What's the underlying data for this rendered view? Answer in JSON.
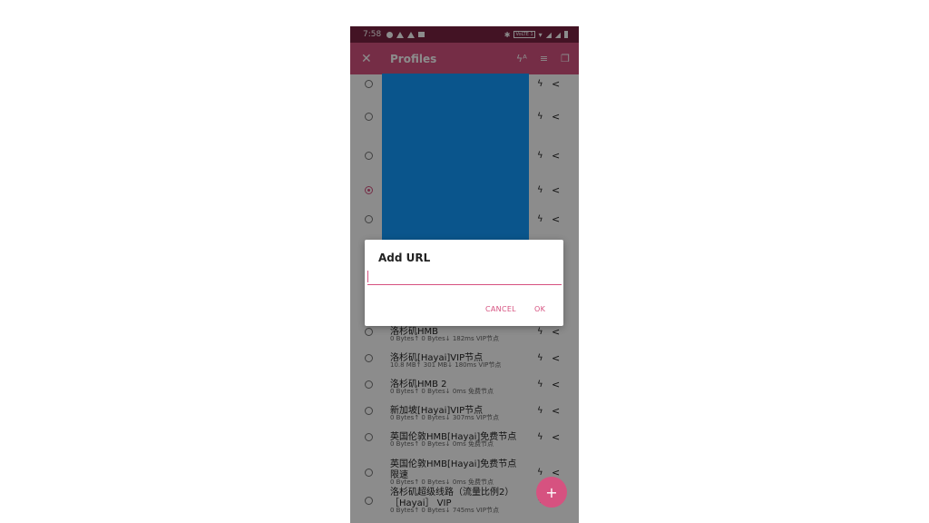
{
  "status_bar": {
    "time": "7:58",
    "network_label": "VoLTE 1"
  },
  "app_bar": {
    "close_icon": "close-icon",
    "title": "Profiles",
    "actions": [
      "speed-test-icon",
      "sort-icon",
      "copy-icon"
    ]
  },
  "profiles": [
    {
      "name": "",
      "info": "",
      "selected": false
    },
    {
      "name": "",
      "info": "",
      "selected": false
    },
    {
      "name": "",
      "info": "",
      "selected": false
    },
    {
      "name": "",
      "info": "",
      "selected": true
    },
    {
      "name": "",
      "info": "",
      "selected": false
    },
    {
      "name": "洛杉矶HMB",
      "info": "0 Bytes↑ 0 Bytes↓ 182ms VIP节点",
      "selected": false
    },
    {
      "name": "洛杉矶[Hayai]VIP节点",
      "info": "10.8 MB↑ 301 MB↓ 180ms VIP节点",
      "selected": false
    },
    {
      "name": "洛杉矶HMB 2",
      "info": "0 Bytes↑ 0 Bytes↓ 0ms 免费节点",
      "selected": false
    },
    {
      "name": "新加坡[Hayai]VIP节点",
      "info": "0 Bytes↑ 0 Bytes↓ 307ms VIP节点",
      "selected": false
    },
    {
      "name": "英国伦敦HMB[Hayai]免费节点",
      "info": "0 Bytes↑ 0 Bytes↓ 0ms 免费节点",
      "selected": false
    },
    {
      "name": "英国伦敦HMB[Hayai]免费节点",
      "name2": "限速",
      "info": "0 Bytes↑ 0 Bytes↓ 0ms 免费节点",
      "selected": false
    },
    {
      "name": "洛杉矶超级线路（流量比例2）",
      "name2": "［Hayai］ VIP",
      "info": "0 Bytes↑ 0 Bytes↓ 745ms VIP节点",
      "selected": false
    }
  ],
  "row_icons": {
    "test": "bolt-icon",
    "share": "share-icon"
  },
  "fab": {
    "label": "+"
  },
  "dialog": {
    "title": "Add URL",
    "input_value": "",
    "cancel_label": "CANCEL",
    "ok_label": "OK"
  },
  "colors": {
    "primary": "#d65280",
    "status_bar": "#7a2342",
    "redaction": "#139cff"
  }
}
